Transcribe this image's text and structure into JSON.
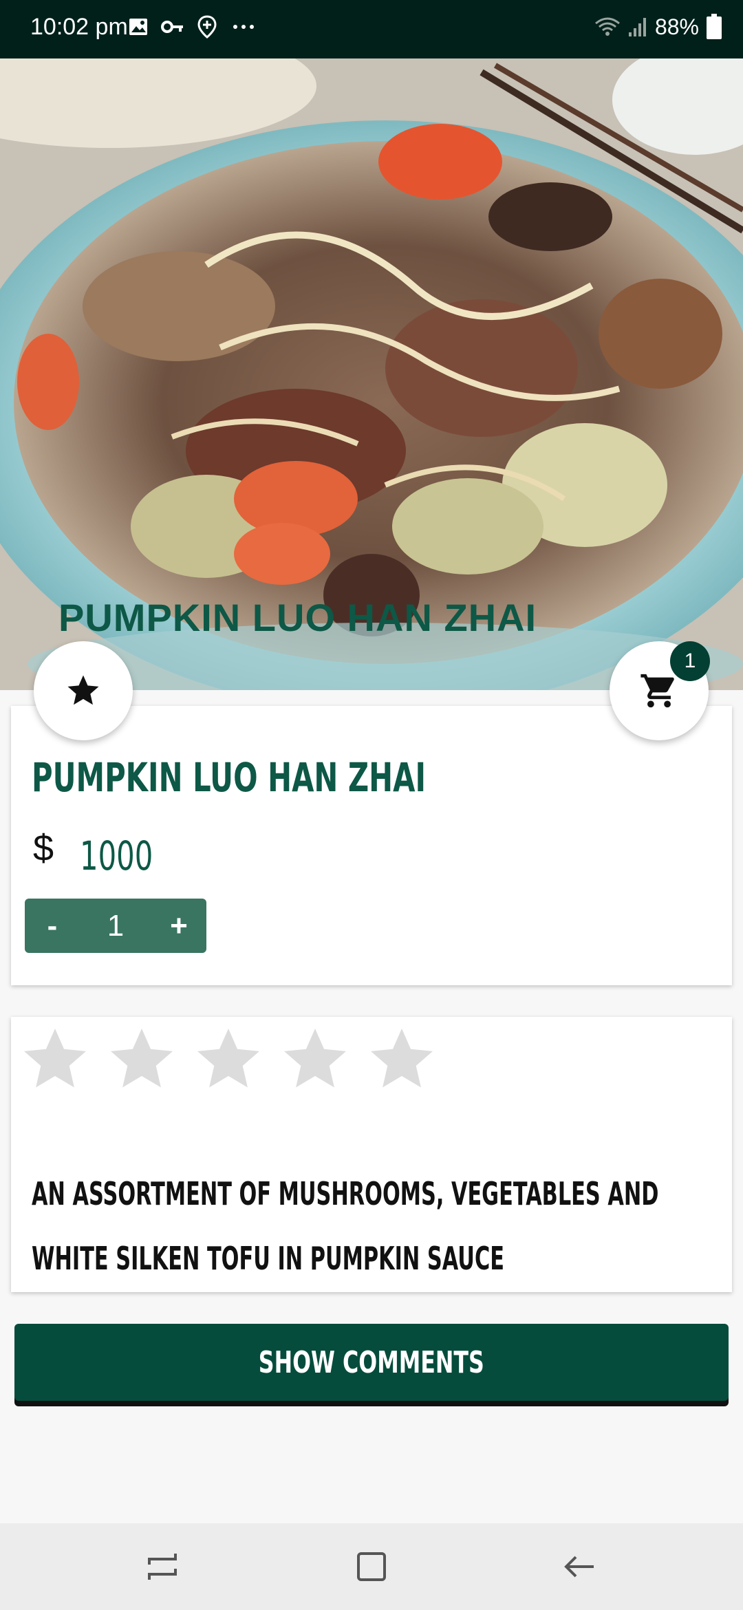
{
  "status_bar": {
    "time": "10:02 pm",
    "battery": "88%",
    "icons_left": [
      "image-icon",
      "key-icon",
      "location-add-icon",
      "more-dots-icon"
    ],
    "icons_right": [
      "wifi-icon",
      "signal-icon",
      "battery-icon"
    ]
  },
  "hero": {
    "title": "PUMPKIN LUO HAN ZHAI",
    "image_description_icon": "dish-photo"
  },
  "fab": {
    "favorite_icon": "star-icon",
    "cart_icon": "cart-icon",
    "cart_count": "1"
  },
  "product": {
    "name": "PUMPKIN LUO HAN ZHAI",
    "currency": "$",
    "price": "1000",
    "quantity": "1",
    "minus_label": "-",
    "plus_label": "+"
  },
  "rating": {
    "value": 0,
    "max": 5
  },
  "description": {
    "text": "AN ASSORTMENT OF MUSHROOMS, VEGETABLES AND WHITE SILKEN TOFU IN PUMPKIN SAUCE"
  },
  "actions": {
    "show_comments": "SHOW COMMENTS"
  },
  "colors": {
    "primary": "#054c3c",
    "accent_text": "#0d5846",
    "star_empty": "#dcdcdc"
  },
  "nav_bar": {
    "icons": [
      "recents-icon",
      "home-icon",
      "back-icon"
    ]
  }
}
